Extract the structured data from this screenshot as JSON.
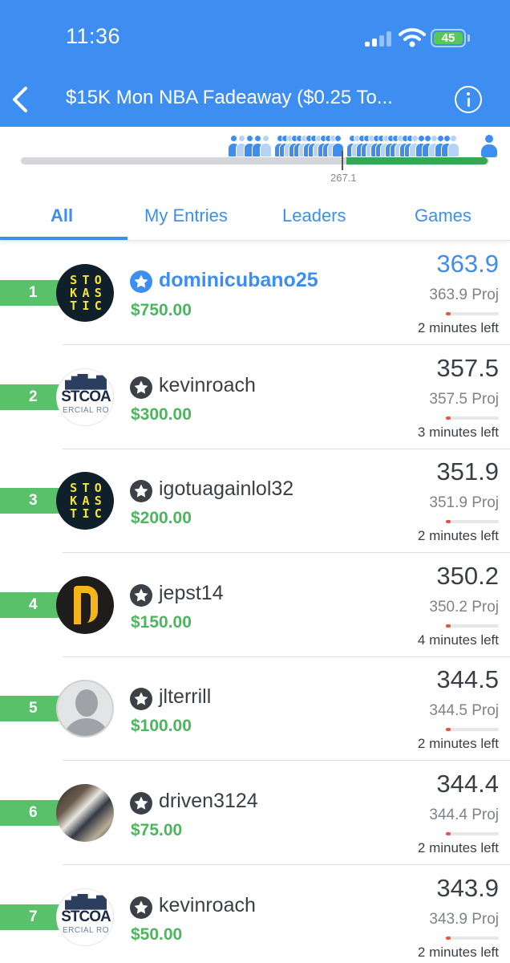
{
  "status_bar": {
    "time": "11:36",
    "battery": "45"
  },
  "header": {
    "title": "$15K Mon NBA Fadeaway ($0.25 To..."
  },
  "progress": {
    "marker_value": "267.1"
  },
  "tabs": [
    {
      "label": "All",
      "active": true
    },
    {
      "label": "My Entries"
    },
    {
      "label": "Leaders"
    },
    {
      "label": "Games"
    }
  ],
  "entries": [
    {
      "rank": "1",
      "avatar": "stokastic",
      "username": "dominicubano25",
      "is_me": true,
      "prize": "$750.00",
      "score": "363.9",
      "proj": "363.9 Proj",
      "time_left": "2 minutes left"
    },
    {
      "rank": "2",
      "avatar": "coast",
      "username": "kevinroach",
      "prize": "$300.00",
      "score": "357.5",
      "proj": "357.5 Proj",
      "time_left": "3 minutes left"
    },
    {
      "rank": "3",
      "avatar": "stokastic",
      "username": "igotuagainlol32",
      "prize": "$200.00",
      "score": "351.9",
      "proj": "351.9 Proj",
      "time_left": "2 minutes left"
    },
    {
      "rank": "4",
      "avatar": "pirates",
      "username": "jepst14",
      "prize": "$150.00",
      "score": "350.2",
      "proj": "350.2 Proj",
      "time_left": "4 minutes left"
    },
    {
      "rank": "5",
      "avatar": "default",
      "username": "jlterrill",
      "prize": "$100.00",
      "score": "344.5",
      "proj": "344.5 Proj",
      "time_left": "2 minutes left"
    },
    {
      "rank": "6",
      "avatar": "photo",
      "username": "driven3124",
      "prize": "$75.00",
      "score": "344.4",
      "proj": "344.4 Proj",
      "time_left": "2 minutes left"
    },
    {
      "rank": "7",
      "avatar": "coast",
      "username": "kevinroach",
      "prize": "$50.00",
      "score": "343.9",
      "proj": "343.9 Proj",
      "time_left": "2 minutes left"
    }
  ],
  "avatar_text": {
    "stokastic": [
      "S",
      "T",
      "O",
      "K",
      "A",
      "S",
      "T",
      "I",
      "C"
    ],
    "coast_word": "STCOA",
    "coast_sub": "ERCIAL RO"
  },
  "colors": {
    "brand_blue": "#3d8ef0",
    "rank_green": "#58c16a",
    "prize_green": "#4cb55e",
    "time_red": "#e5534b"
  }
}
